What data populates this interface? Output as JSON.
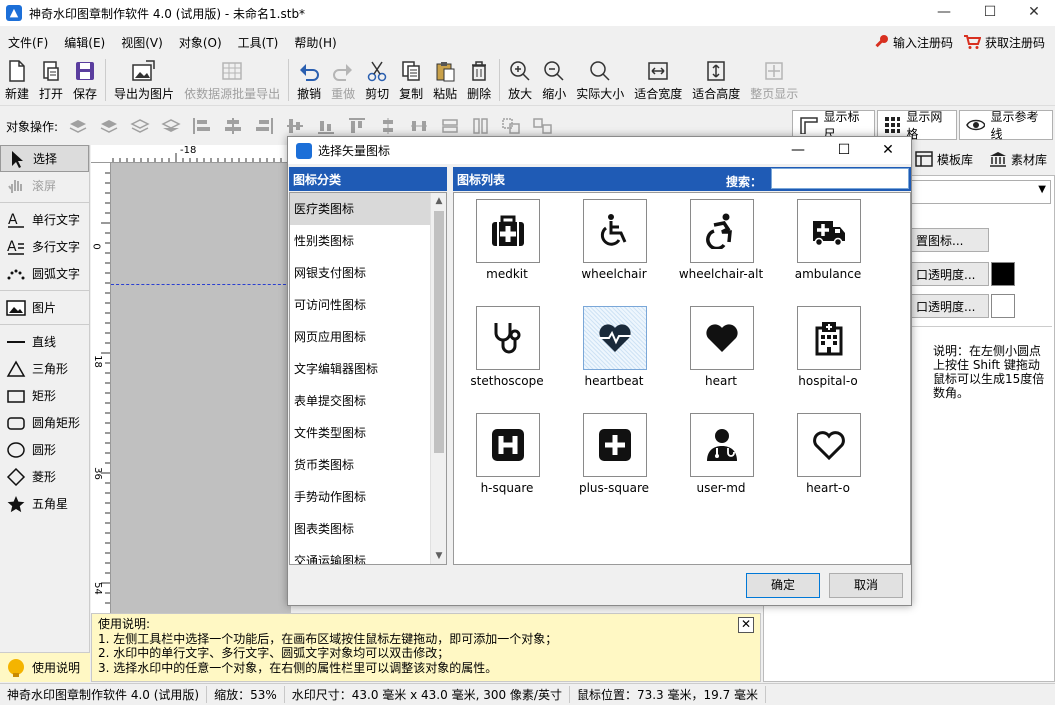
{
  "window": {
    "title": "神奇水印图章制作软件 4.0 (试用版) - 未命名1.stb*",
    "minimize": "—",
    "maximize": "☐",
    "close": "✕"
  },
  "menu": {
    "items": [
      "文件(F)",
      "编辑(E)",
      "视图(V)",
      "对象(O)",
      "工具(T)",
      "帮助(H)"
    ],
    "register": "输入注册码",
    "get_code": "获取注册码"
  },
  "toolbar": {
    "buttons": [
      {
        "label": "新建",
        "icon": "new-file-icon"
      },
      {
        "label": "打开",
        "icon": "open-icon"
      },
      {
        "label": "保存",
        "icon": "save-icon"
      },
      {
        "label": "导出为图片",
        "icon": "export-image-icon"
      },
      {
        "label": "依数据源批量导出",
        "icon": "batch-export-icon"
      },
      {
        "label": "撤销",
        "icon": "undo-icon"
      },
      {
        "label": "重做",
        "icon": "redo-icon"
      },
      {
        "label": "剪切",
        "icon": "cut-icon"
      },
      {
        "label": "复制",
        "icon": "copy-icon"
      },
      {
        "label": "粘贴",
        "icon": "paste-icon"
      },
      {
        "label": "删除",
        "icon": "delete-icon"
      },
      {
        "label": "放大",
        "icon": "zoom-in-icon"
      },
      {
        "label": "缩小",
        "icon": "zoom-out-icon"
      },
      {
        "label": "实际大小",
        "icon": "actual-size-icon"
      },
      {
        "label": "适合宽度",
        "icon": "fit-width-icon"
      },
      {
        "label": "适合高度",
        "icon": "fit-height-icon"
      },
      {
        "label": "整页显示",
        "icon": "fit-page-icon"
      }
    ]
  },
  "ops": {
    "label": "对象操作:",
    "show_ruler": "显示标尺",
    "show_grid": "显示网格",
    "show_guides": "显示参考线"
  },
  "tools": {
    "select": "选择",
    "scroll": "滚屏",
    "single_text": "单行文字",
    "multi_text": "多行文字",
    "arc_text": "圆弧文字",
    "image": "图片",
    "line": "直线",
    "triangle": "三角形",
    "rect": "矩形",
    "round_rect": "圆角矩形",
    "circle": "圆形",
    "diamond": "菱形",
    "star": "五角星",
    "help": "使用说明"
  },
  "ruler": {
    "h_label": "-18",
    "v_labels": [
      "0",
      "18",
      "36",
      "54"
    ]
  },
  "help_note": {
    "title": "使用说明:",
    "lines": [
      "1. 左侧工具栏中选择一个功能后，在画布区域按住鼠标左键拖动，即可添加一个对象；",
      "2. 水印中的单行文字、多行文字、圆弧文字对象均可以双击修改；",
      "3. 选择水印中的任意一个对象，在右侧的属性栏里可以调整该对象的属性。"
    ]
  },
  "right_panel": {
    "tab_template": "模板库",
    "tab_material": "素材库",
    "btn_icon": "置图标...",
    "btn_trans1": "口透明度...",
    "btn_trans2": "口透明度...",
    "note": "说明：在左侧小圆点上按住 Shift 键拖动鼠标可以生成15度倍数角。",
    "swatch1": "#000000",
    "swatch2": "#ffffff"
  },
  "dialog": {
    "title": "选择矢量图标",
    "cat_header": "图标分类",
    "list_header": "图标列表",
    "search_label": "搜索：",
    "search_value": "",
    "categories": [
      "医疗类图标",
      "性别类图标",
      "网银支付图标",
      "可访问性图标",
      "网页应用图标",
      "文字编辑器图标",
      "表单提交图标",
      "文件类型图标",
      "货币类图标",
      "手势动作图标",
      "图表类图标",
      "交通运输图标"
    ],
    "icons": [
      "medkit",
      "wheelchair",
      "wheelchair-alt",
      "ambulance",
      "stethoscope",
      "heartbeat",
      "heart",
      "hospital-o",
      "h-square",
      "plus-square",
      "user-md",
      "heart-o"
    ],
    "ok": "确定",
    "cancel": "取消"
  },
  "status": {
    "app": "神奇水印图章制作软件 4.0 (试用版)",
    "zoom": "缩放：53%",
    "size": "水印尺寸：43.0 毫米 x 43.0 毫米, 300 像素/英寸",
    "mouse": "鼠标位置：73.3 毫米，19.7 毫米"
  }
}
